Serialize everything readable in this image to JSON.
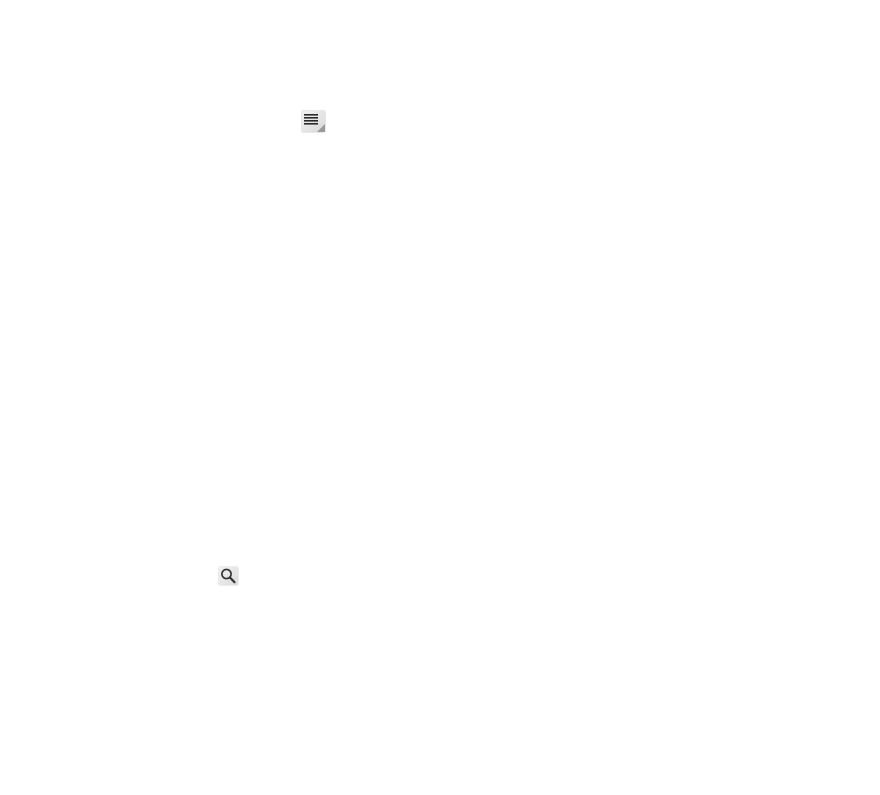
{
  "toolbar": {
    "menu_icon": "list-menu-icon",
    "search_icon": "magnifier-search-icon"
  },
  "colors": {
    "background": "#ffffff",
    "icon_bg": "#e4e4e4",
    "icon_glyph": "#333333",
    "rule": "#555555"
  }
}
